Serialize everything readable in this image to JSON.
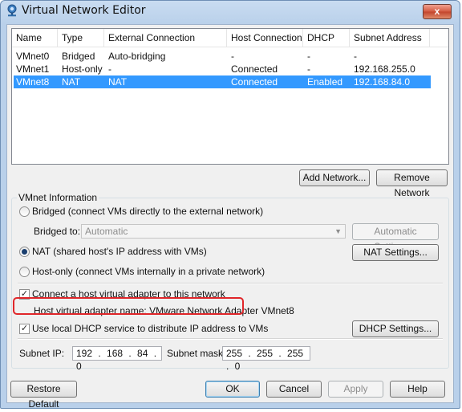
{
  "window": {
    "title": "Virtual Network Editor",
    "close_label": "x"
  },
  "table": {
    "columns": [
      "Name",
      "Type",
      "External Connection",
      "Host Connection",
      "DHCP",
      "Subnet Address"
    ],
    "rows": [
      {
        "name": "VMnet0",
        "type": "Bridged",
        "external": "Auto-bridging",
        "host": "-",
        "dhcp": "-",
        "subnet": "-"
      },
      {
        "name": "VMnet1",
        "type": "Host-only",
        "external": "-",
        "host": "Connected",
        "dhcp": "-",
        "subnet": "192.168.255.0"
      },
      {
        "name": "VMnet8",
        "type": "NAT",
        "external": "NAT",
        "host": "Connected",
        "dhcp": "Enabled",
        "subnet": "192.168.84.0"
      }
    ],
    "selected_row": "VMnet8"
  },
  "buttons": {
    "add_network": "Add Network...",
    "remove_network": "Remove Network",
    "automatic_settings": "Automatic Settings...",
    "nat_settings": "NAT Settings...",
    "dhcp_settings": "DHCP Settings...",
    "restore_default": "Restore Default",
    "ok": "OK",
    "cancel": "Cancel",
    "apply": "Apply",
    "help": "Help"
  },
  "vmnet_info": {
    "group_label": "VMnet Information",
    "bridged_label": "Bridged (connect VMs directly to the external network)",
    "bridged_to_label": "Bridged to:",
    "bridged_to_value": "Automatic",
    "nat_label": "NAT (shared host's IP address with VMs)",
    "hostonly_label": "Host-only (connect VMs internally in a private network)",
    "selected_mode": "NAT",
    "connect_adapter_label": "Connect a host virtual adapter to this network",
    "connect_adapter_checked": true,
    "adapter_name_text": "Host virtual adapter name: VMware Network Adapter VMnet8",
    "use_dhcp_label": "Use local DHCP service to distribute IP address to VMs",
    "use_dhcp_checked": true,
    "subnet_ip_label": "Subnet IP:",
    "subnet_ip_value": "192 . 168 . 84 . 0",
    "subnet_mask_label": "Subnet mask:",
    "subnet_mask_value": "255 . 255 . 255 . 0"
  },
  "icons": {
    "app": "network-icon",
    "close": "close-icon",
    "check": "✓"
  },
  "colors": {
    "selection": "#3399ff",
    "highlight_box": "#e0262a"
  }
}
